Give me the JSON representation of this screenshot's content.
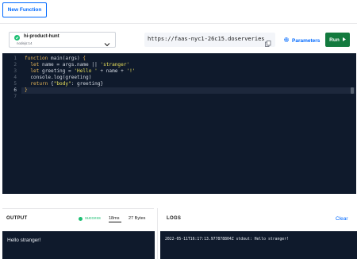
{
  "toolbar": {
    "new_function_label": "New Function"
  },
  "function_select": {
    "name": "hi-product-hunt",
    "runtime": "nodejs:14"
  },
  "url": {
    "value": "https://faas-nyc1-26c15.doserveries"
  },
  "params_label": "Parameters",
  "run_label": "Run",
  "editor": {
    "line_numbers": [
      "1",
      "2",
      "3",
      "4",
      "5",
      "6",
      "7"
    ],
    "active_line": 6
  },
  "output": {
    "title": "OUTPUT",
    "status": "success",
    "duration": "18ms",
    "size": "27 Bytes",
    "text": "Hello stranger!"
  },
  "logs": {
    "title": "LOGS",
    "clear_label": "Clear",
    "text": "2022-05-11T16:17:13.977878804Z stdout: Hello stranger!"
  },
  "colors": {
    "accent": "#0069ff",
    "run_button": "#137a3e",
    "success": "#1dbf73",
    "editor_bg": "#0f1a2c"
  }
}
